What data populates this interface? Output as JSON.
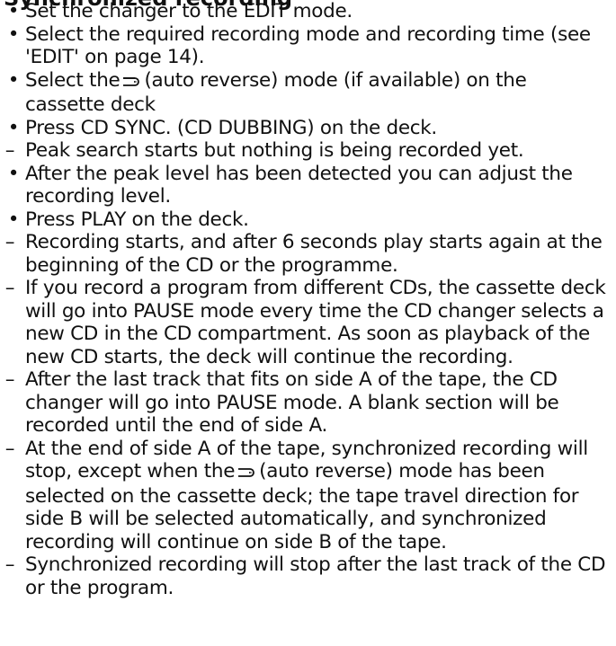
{
  "heading_partial": "Synchronized recording",
  "items": [
    {
      "marker": "•",
      "kind": "bullet",
      "text": "Set the changer to the EDIT mode."
    },
    {
      "marker": "•",
      "kind": "bullet",
      "text": "Select the required recording mode and recording time (see 'EDIT' on page 14)."
    },
    {
      "marker": "•",
      "kind": "bullet",
      "pre": "Select the",
      "icon": "auto-reverse-icon",
      "post": "(auto reverse) mode (if available) on the cassette deck"
    },
    {
      "marker": "•",
      "kind": "bullet",
      "text": "Press CD SYNC. (CD DUBBING) on the deck."
    },
    {
      "marker": "–",
      "kind": "dash",
      "text": "Peak search starts but nothing is being recorded yet."
    },
    {
      "marker": "•",
      "kind": "bullet",
      "text": "After the peak level has been detected you can adjust the recording level."
    },
    {
      "marker": "•",
      "kind": "bullet",
      "text": "Press PLAY on the deck."
    },
    {
      "marker": "–",
      "kind": "dash",
      "text": "Recording starts, and after 6 seconds play starts again at the beginning of the CD or the programme."
    },
    {
      "marker": "–",
      "kind": "dash",
      "text": "If you record a program from different CDs, the cassette deck will go into PAUSE mode every time the CD changer selects a new CD in the CD compartment. As soon as playback of the new CD starts, the deck will continue the recording."
    },
    {
      "marker": "–",
      "kind": "dash",
      "text": "After the last track that fits on side A of the tape, the CD changer will go into PAUSE mode. A blank section will be recorded until the end of side A."
    },
    {
      "marker": "–",
      "kind": "dash",
      "pre": "At the end of side A of the tape, synchronized recording will stop, except when the",
      "icon": "auto-reverse-icon",
      "post": "(auto reverse) mode has been selected on the cassette deck; the tape travel direction for side B will be selected automatically, and synchronized recording will continue on side B of the tape."
    },
    {
      "marker": "–",
      "kind": "dash",
      "text": "Synchronized recording will stop after the last track of the CD or the program."
    }
  ]
}
